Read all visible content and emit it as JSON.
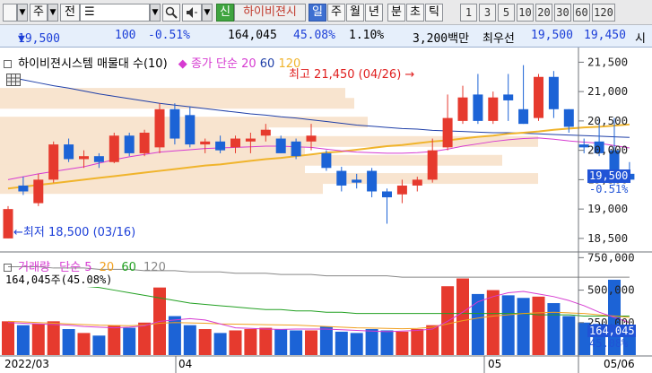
{
  "toolbar": {
    "stock_code_placeholder": "",
    "period_unit_label": "주",
    "stock_type_label": "전",
    "stock_type_value": "☰",
    "search_icon": "magnifier-icon",
    "sound_icon": "speaker-icon",
    "new_high_badge": "신",
    "stock_name": "하이비젼시",
    "period_tabs": [
      "일",
      "주",
      "월",
      "년",
      "분",
      "초",
      "틱"
    ],
    "active_period": "일",
    "intervals": [
      "1",
      "3",
      "5",
      "10",
      "20",
      "30",
      "60",
      "120"
    ]
  },
  "quote": {
    "price": "19,500",
    "change_arrow": "▼",
    "change": "100",
    "change_rate": "-0.51%",
    "volume": "164,045",
    "volume_ratio": "45.08%",
    "turnover_rate": "1.10%",
    "amount": "3,200백만",
    "priority_label": "최우선",
    "ask": "19,500",
    "bid": "19,450",
    "trailing": "시"
  },
  "price_chart": {
    "legend_title": "하이비젼시스템 매물대 수(10)",
    "ma_legend_prefix": "종가 단순",
    "ma_legend_periods": [
      "20",
      "60",
      "120"
    ],
    "high_annotation": "최고 21,450 (04/26)",
    "low_annotation": "최저 18,500 (03/16)",
    "current_price_tag": "19,500",
    "current_rate_tag": "-0.51%",
    "colors": {
      "up": "#e63a2e",
      "down": "#1c63d6",
      "ma20": "#d63bd1",
      "ma60": "#1f3fa8",
      "ma120": "#f0b42c",
      "profile": "#f8e4cf"
    }
  },
  "volume_chart": {
    "legend_title": "거래량",
    "ma_legend_prefix": "단순",
    "ma_legend_periods": [
      "5",
      "20",
      "60",
      "120"
    ],
    "volume_annotation": "164,045주(45.08%)",
    "current_volume_tag": "164,045",
    "current_ratio_tag": "45.08%"
  },
  "x_axis": {
    "labels": [
      "2022/03",
      "04",
      "05",
      "05/06"
    ]
  },
  "chart_data": {
    "type": "candlestick",
    "price_axis": {
      "ticks": [
        "21,500",
        "21,000",
        "20,500",
        "20,000",
        "19,500",
        "19,000",
        "18,500"
      ],
      "ylim": [
        18300,
        21750
      ]
    },
    "volume_axis": {
      "ticks": [
        "750,000",
        "500,000",
        "250,000"
      ],
      "ylim": [
        0,
        780000
      ]
    },
    "candles": [
      {
        "o": 18500,
        "h": 19050,
        "l": 18500,
        "c": 19000,
        "v": 260000
      },
      {
        "o": 19400,
        "h": 19550,
        "l": 19240,
        "c": 19300,
        "v": 230000
      },
      {
        "o": 19100,
        "h": 19600,
        "l": 19050,
        "c": 19500,
        "v": 240000
      },
      {
        "o": 19500,
        "h": 20150,
        "l": 19450,
        "c": 20100,
        "v": 260000
      },
      {
        "o": 20100,
        "h": 20200,
        "l": 19800,
        "c": 19850,
        "v": 200000
      },
      {
        "o": 19850,
        "h": 20000,
        "l": 19700,
        "c": 19900,
        "v": 170000
      },
      {
        "o": 19900,
        "h": 19950,
        "l": 19700,
        "c": 19800,
        "v": 150000
      },
      {
        "o": 19800,
        "h": 20300,
        "l": 19780,
        "c": 20250,
        "v": 230000
      },
      {
        "o": 20250,
        "h": 20300,
        "l": 19900,
        "c": 19950,
        "v": 210000
      },
      {
        "o": 19950,
        "h": 20350,
        "l": 19900,
        "c": 20300,
        "v": 250000
      },
      {
        "o": 20050,
        "h": 20800,
        "l": 19950,
        "c": 20700,
        "v": 520000
      },
      {
        "o": 20700,
        "h": 20800,
        "l": 20100,
        "c": 20200,
        "v": 300000
      },
      {
        "o": 20600,
        "h": 20750,
        "l": 20050,
        "c": 20100,
        "v": 230000
      },
      {
        "o": 20100,
        "h": 20200,
        "l": 19950,
        "c": 20150,
        "v": 200000
      },
      {
        "o": 20150,
        "h": 20250,
        "l": 19950,
        "c": 20000,
        "v": 170000
      },
      {
        "o": 20050,
        "h": 20250,
        "l": 19950,
        "c": 20200,
        "v": 190000
      },
      {
        "o": 20150,
        "h": 20300,
        "l": 19950,
        "c": 20200,
        "v": 200000
      },
      {
        "o": 20250,
        "h": 20450,
        "l": 20150,
        "c": 20350,
        "v": 210000
      },
      {
        "o": 20200,
        "h": 20250,
        "l": 19950,
        "c": 19950,
        "v": 200000
      },
      {
        "o": 20150,
        "h": 20200,
        "l": 19850,
        "c": 19900,
        "v": 190000
      },
      {
        "o": 20150,
        "h": 20450,
        "l": 20000,
        "c": 20250,
        "v": 190000
      },
      {
        "o": 19950,
        "h": 20000,
        "l": 19650,
        "c": 19700,
        "v": 220000
      },
      {
        "o": 19650,
        "h": 19720,
        "l": 19300,
        "c": 19400,
        "v": 180000
      },
      {
        "o": 19500,
        "h": 19600,
        "l": 19350,
        "c": 19450,
        "v": 170000
      },
      {
        "o": 19650,
        "h": 19700,
        "l": 19200,
        "c": 19300,
        "v": 200000
      },
      {
        "o": 19300,
        "h": 19350,
        "l": 18750,
        "c": 19200,
        "v": 190000
      },
      {
        "o": 19250,
        "h": 19500,
        "l": 19100,
        "c": 19400,
        "v": 180000
      },
      {
        "o": 19400,
        "h": 19550,
        "l": 19300,
        "c": 19500,
        "v": 200000
      },
      {
        "o": 19500,
        "h": 20200,
        "l": 19450,
        "c": 20000,
        "v": 230000
      },
      {
        "o": 20050,
        "h": 20950,
        "l": 20000,
        "c": 20550,
        "v": 530000
      },
      {
        "o": 20500,
        "h": 21100,
        "l": 20450,
        "c": 20900,
        "v": 590000
      },
      {
        "o": 20950,
        "h": 21300,
        "l": 20450,
        "c": 20500,
        "v": 470000
      },
      {
        "o": 20500,
        "h": 21000,
        "l": 20450,
        "c": 20900,
        "v": 500000
      },
      {
        "o": 20950,
        "h": 21300,
        "l": 20500,
        "c": 20850,
        "v": 460000
      },
      {
        "o": 20700,
        "h": 21450,
        "l": 20450,
        "c": 20450,
        "v": 440000
      },
      {
        "o": 20550,
        "h": 21300,
        "l": 20500,
        "c": 21250,
        "v": 450000
      },
      {
        "o": 21250,
        "h": 21350,
        "l": 20550,
        "c": 20700,
        "v": 400000
      },
      {
        "o": 20700,
        "h": 20700,
        "l": 20300,
        "c": 20400,
        "v": 300000
      },
      {
        "o": 20100,
        "h": 20200,
        "l": 19950,
        "c": 20050,
        "v": 250000
      },
      {
        "o": 20150,
        "h": 20550,
        "l": 19900,
        "c": 19950,
        "v": 240000
      },
      {
        "o": 20000,
        "h": 20550,
        "l": 19400,
        "c": 19600,
        "v": 580000
      },
      {
        "o": 19600,
        "h": 19800,
        "l": 19450,
        "c": 19500,
        "v": 164045
      }
    ],
    "volume_profile": [
      20970,
      20800,
      20480,
      20320,
      20150,
      19990,
      19830,
      19670,
      19520,
      19350
    ],
    "ma20_price": [
      19500,
      19550,
      19600,
      19640,
      19680,
      19720,
      19780,
      19840,
      19890,
      19930,
      19970,
      19990,
      20010,
      20030,
      20040,
      20050,
      20060,
      20070,
      20070,
      20060,
      20050,
      20020,
      19990,
      19970,
      19960,
      19950,
      19950,
      19960,
      19980,
      20020,
      20070,
      20110,
      20150,
      20180,
      20200,
      20210,
      20190,
      20160,
      20140,
      20120,
      20080,
      20040
    ],
    "ma60_price": [
      21250,
      21200,
      21150,
      21100,
      21060,
      21010,
      20960,
      20920,
      20880,
      20840,
      20800,
      20770,
      20740,
      20710,
      20680,
      20650,
      20620,
      20600,
      20570,
      20550,
      20520,
      20490,
      20460,
      20430,
      20410,
      20390,
      20370,
      20360,
      20340,
      20330,
      20320,
      20310,
      20300,
      20300,
      20290,
      20280,
      20270,
      20260,
      20250,
      20240,
      20230,
      20220
    ],
    "ma120_price": [
      19350,
      19380,
      19410,
      19440,
      19470,
      19500,
      19530,
      19560,
      19590,
      19620,
      19650,
      19680,
      19710,
      19740,
      19760,
      19790,
      19820,
      19850,
      19870,
      19900,
      19930,
      19960,
      19980,
      20010,
      20040,
      20070,
      20090,
      20120,
      20150,
      20170,
      20200,
      20230,
      20250,
      20280,
      20300,
      20320,
      20350,
      20370,
      20390,
      20400,
      20420,
      20440
    ],
    "vol_ma60": [
      560000,
      560000,
      550000,
      550000,
      540000,
      530000,
      520000,
      500000,
      480000,
      460000,
      440000,
      420000,
      400000,
      390000,
      380000,
      370000,
      360000,
      350000,
      350000,
      340000,
      340000,
      330000,
      330000,
      320000,
      320000,
      320000,
      320000,
      320000,
      320000,
      320000,
      320000,
      320000,
      320000,
      320000,
      320000,
      310000,
      310000,
      310000,
      300000,
      300000,
      300000,
      300000
    ],
    "vol_ma120": [
      680000,
      680000,
      680000,
      670000,
      670000,
      670000,
      660000,
      660000,
      660000,
      650000,
      650000,
      650000,
      640000,
      640000,
      640000,
      630000,
      630000,
      630000,
      620000,
      620000,
      620000,
      610000,
      610000,
      610000,
      610000,
      610000,
      600000,
      600000,
      600000,
      600000,
      600000,
      600000,
      600000,
      600000,
      600000,
      600000,
      600000,
      600000,
      600000,
      600000,
      600000,
      600000
    ],
    "vol_ma20": [
      260000,
      255000,
      250000,
      245000,
      240000,
      235000,
      230000,
      228000,
      226000,
      230000,
      245000,
      250000,
      248000,
      245000,
      240000,
      238000,
      236000,
      234000,
      232000,
      230000,
      225000,
      220000,
      215000,
      210000,
      208000,
      205000,
      203000,
      205000,
      215000,
      240000,
      265000,
      285000,
      300000,
      310000,
      320000,
      325000,
      330000,
      325000,
      320000,
      310000,
      300000,
      290000
    ],
    "vol_ma5": [
      250000,
      245000,
      240000,
      235000,
      230000,
      220000,
      215000,
      210000,
      215000,
      225000,
      260000,
      270000,
      280000,
      270000,
      240000,
      210000,
      205000,
      200000,
      198000,
      200000,
      200000,
      200000,
      195000,
      190000,
      185000,
      180000,
      185000,
      190000,
      200000,
      260000,
      330000,
      410000,
      450000,
      480000,
      490000,
      470000,
      450000,
      420000,
      380000,
      330000,
      290000,
      250000
    ]
  }
}
